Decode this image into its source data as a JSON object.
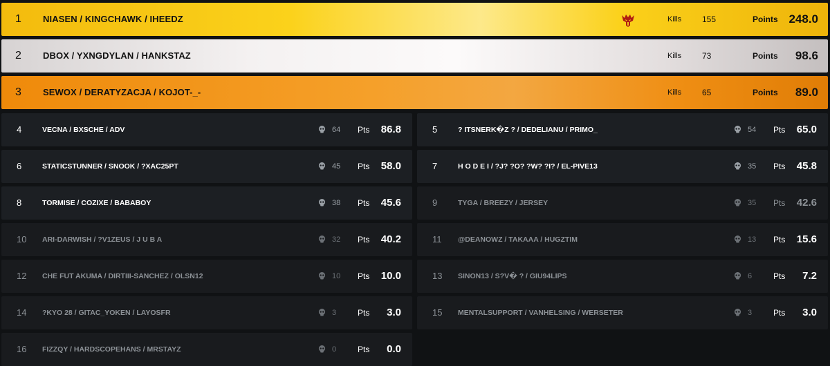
{
  "podium": [
    {
      "rank": "1",
      "team": "NIASEN / KINGCHAWK / IHEEDZ",
      "kills_label": "Kills",
      "kills": "155",
      "points_label": "Points",
      "points": "248.0",
      "logo": "team-logo-icon"
    },
    {
      "rank": "2",
      "team": "DBOX / YXNGDYLAN / HANKSTAZ",
      "kills_label": "Kills",
      "kills": "73",
      "points_label": "Points",
      "points": "98.6"
    },
    {
      "rank": "3",
      "team": "SEWOX / DERATYZACJA / KOJOT-_-",
      "kills_label": "Kills",
      "kills": "65",
      "points_label": "Points",
      "points": "89.0"
    }
  ],
  "leaderboard": [
    {
      "rank": "4",
      "team": "VECNA / BXSCHE / ADV",
      "kills": "64",
      "pts_label": "Pts",
      "pts": "86.8"
    },
    {
      "rank": "5",
      "team": "? ITSNERK�Z ? / DEDELIANU / PRIMO_",
      "kills": "54",
      "pts_label": "Pts",
      "pts": "65.0"
    },
    {
      "rank": "6",
      "team": "STATICSTUNNER / SNOOK / ?XAC25PT",
      "kills": "45",
      "pts_label": "Pts",
      "pts": "58.0"
    },
    {
      "rank": "7",
      "team": "H O D E I / ?J? ?O? ?W? ?I? / EL-PIVE13",
      "kills": "35",
      "pts_label": "Pts",
      "pts": "45.8"
    },
    {
      "rank": "8",
      "team": "TORMISE / COZIXE / BABABOY",
      "kills": "38",
      "pts_label": "Pts",
      "pts": "45.6"
    },
    {
      "rank": "9",
      "team": "TYGA / BREEZY / JERSEY",
      "kills": "35",
      "pts_label": "Pts",
      "pts": "42.6"
    },
    {
      "rank": "10",
      "team": "ARI-DARWISH / ?V1ZEUS / J U B A",
      "kills": "32",
      "pts_label": "Pts",
      "pts": "40.2"
    },
    {
      "rank": "11",
      "team": "@DEANOWZ / TAKAAA / HUGZTIM",
      "kills": "13",
      "pts_label": "Pts",
      "pts": "15.6"
    },
    {
      "rank": "12",
      "team": "CHE FUT AKUMA / DIRTIII-SANCHEZ / OLSN12",
      "kills": "10",
      "pts_label": "Pts",
      "pts": "10.0"
    },
    {
      "rank": "13",
      "team": "SINON13 / S?V� ? / GIU94LIPS",
      "kills": "6",
      "pts_label": "Pts",
      "pts": "7.2"
    },
    {
      "rank": "14",
      "team": "?KYO 28 / GITAC_YOKEN / LAYOSFR",
      "kills": "3",
      "pts_label": "Pts",
      "pts": "3.0"
    },
    {
      "rank": "15",
      "team": "MENTALSUPPORT / VANHELSING / WERSETER",
      "kills": "3",
      "pts_label": "Pts",
      "pts": "3.0"
    },
    {
      "rank": "16",
      "team": "FIZZQY / HARDSCOPEHANS / MRSTAYZ",
      "kills": "0",
      "pts_label": "Pts",
      "pts": "0.0"
    }
  ],
  "colors": {
    "background": "#101214",
    "card": "#1c1f23",
    "gold": "#fbd21b",
    "silver": "#f4f1f1",
    "bronze": "#f5a02a",
    "logo_red": "#b01c12"
  }
}
